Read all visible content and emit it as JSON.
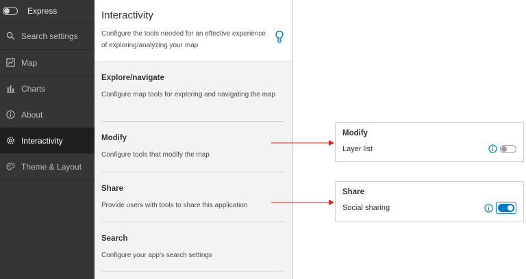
{
  "sidebar": {
    "mode_label": "Express",
    "search_label": "Search settings",
    "items": [
      {
        "label": "Map",
        "icon": "map-icon"
      },
      {
        "label": "Charts",
        "icon": "chart-icon"
      },
      {
        "label": "About",
        "icon": "info-icon"
      },
      {
        "label": "Interactivity",
        "icon": "gear-icon",
        "active": true
      },
      {
        "label": "Theme & Layout",
        "icon": "palette-icon"
      }
    ]
  },
  "main": {
    "title": "Interactivity",
    "description": "Configure the tools needed for an effective experience of exploring/analyzing your map",
    "sections": [
      {
        "title": "Explore/navigate",
        "description": "Configure map tools for exploring and navigating the map"
      },
      {
        "title": "Modify",
        "description": "Configure tools that modify the map"
      },
      {
        "title": "Share",
        "description": "Provide users with tools to share this application"
      },
      {
        "title": "Search",
        "description": "Configure your app's search settings"
      }
    ]
  },
  "callouts": {
    "modify": {
      "title": "Modify",
      "option_label": "Layer list",
      "enabled": false
    },
    "share": {
      "title": "Share",
      "option_label": "Social sharing",
      "enabled": true
    }
  },
  "colors": {
    "accent": "#0079c1",
    "arrow": "#e0201b",
    "sidebar_bg": "#353535",
    "sidebar_active": "#1f1f1f"
  }
}
